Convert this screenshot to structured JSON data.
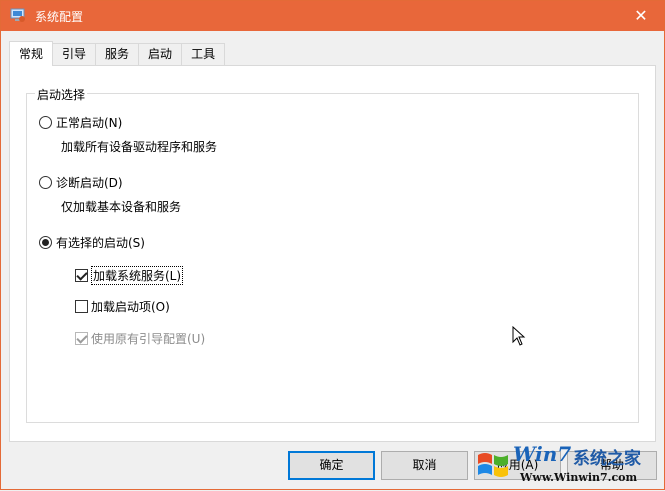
{
  "window": {
    "title": "系统配置",
    "close_glyph": "✕"
  },
  "tabs": [
    {
      "label": "常规",
      "active": true
    },
    {
      "label": "引导",
      "active": false
    },
    {
      "label": "服务",
      "active": false
    },
    {
      "label": "启动",
      "active": false
    },
    {
      "label": "工具",
      "active": false
    }
  ],
  "startup": {
    "group_label": "启动选择",
    "normal": {
      "label": "正常启动(N)",
      "desc": "加载所有设备驱动程序和服务",
      "checked": false
    },
    "diagnostic": {
      "label": "诊断启动(D)",
      "desc": "仅加载基本设备和服务",
      "checked": false
    },
    "selective": {
      "label": "有选择的启动(S)",
      "checked": true
    },
    "options": {
      "load_services": {
        "label": "加载系统服务(L)",
        "checked": true
      },
      "load_startup": {
        "label": "加载启动项(O)",
        "checked": false
      },
      "use_boot_config": {
        "label": "使用原有引导配置(U)",
        "checked": true,
        "disabled": true
      }
    }
  },
  "buttons": {
    "ok": "确定",
    "cancel": "取消",
    "apply": "应用(A)",
    "help": "帮助"
  },
  "watermark": {
    "brand": "Win7",
    "cn": "系统之家",
    "url": "Www.Winwin7.com"
  },
  "colors": {
    "titlebar": "#e8673a",
    "focus": "#0078d7"
  }
}
